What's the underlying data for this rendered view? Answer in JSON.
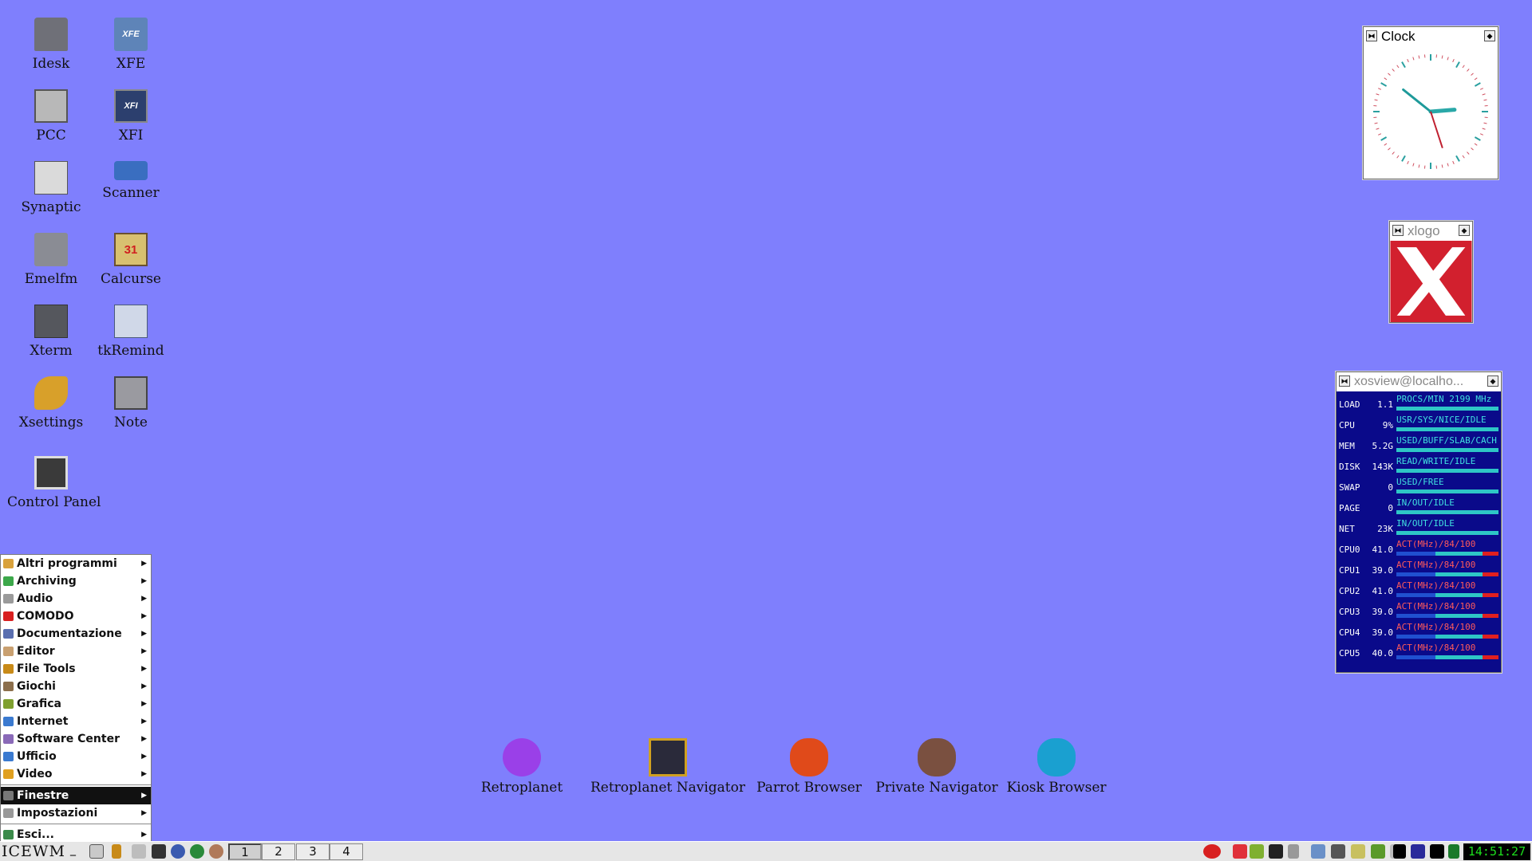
{
  "desktop_icons": [
    {
      "label": "Idesk",
      "icon": "idesk-icon"
    },
    {
      "label": "XFE",
      "icon": "xfe-icon",
      "text": "XFE"
    },
    {
      "label": "PCC",
      "icon": "pcc-icon"
    },
    {
      "label": "XFI",
      "icon": "xfi-icon",
      "text": "XFI"
    },
    {
      "label": "Synaptic",
      "icon": "synaptic-icon"
    },
    {
      "label": "Scanner",
      "icon": "scanner-icon"
    },
    {
      "label": "Emelfm",
      "icon": "emelfm-icon"
    },
    {
      "label": "Calcurse",
      "icon": "calcurse-icon",
      "text": "31"
    },
    {
      "label": "Xterm",
      "icon": "xterm-icon"
    },
    {
      "label": "tkRemind",
      "icon": "tkremind-icon"
    },
    {
      "label": "Xsettings",
      "icon": "xsettings-icon"
    },
    {
      "label": "Note",
      "icon": "note-icon"
    },
    {
      "label": "Control Panel",
      "icon": "control-panel-icon"
    }
  ],
  "bottom_icons": [
    {
      "label": "Retroplanet",
      "icon": "retroplanet-icon"
    },
    {
      "label": "Retroplanet Navigator",
      "icon": "retroplanet-navigator-icon"
    },
    {
      "label": "Parrot Browser",
      "icon": "parrot-browser-icon"
    },
    {
      "label": "Private Navigator",
      "icon": "private-navigator-icon"
    },
    {
      "label": "Kiosk Browser",
      "icon": "kiosk-browser-icon"
    }
  ],
  "start_menu": {
    "items": [
      {
        "label": "Altri programmi",
        "color": "#d9a23c"
      },
      {
        "label": "Archiving",
        "color": "#3ca84a"
      },
      {
        "label": "Audio",
        "color": "#9a9a9a"
      },
      {
        "label": "COMODO",
        "color": "#d82020"
      },
      {
        "label": "Documentazione",
        "color": "#5a6fb0"
      },
      {
        "label": "Editor",
        "color": "#c9a070"
      },
      {
        "label": "File Tools",
        "color": "#c88a18"
      },
      {
        "label": "Giochi",
        "color": "#8c6f4c"
      },
      {
        "label": "Grafica",
        "color": "#7fa030"
      },
      {
        "label": "Internet",
        "color": "#3b7ad0"
      },
      {
        "label": "Software Center",
        "color": "#8a6ab8"
      },
      {
        "label": "Ufficio",
        "color": "#3b7ad0"
      },
      {
        "label": "Video",
        "color": "#e0a020"
      }
    ],
    "selected": "Finestre",
    "settings": "Impostazioni",
    "exit": "Esci..."
  },
  "clock_window": {
    "title": "Clock",
    "time": "14:51:27",
    "hour": 14,
    "minute": 51,
    "second": 27
  },
  "xlogo_window": {
    "title": "xlogo",
    "accent": "#d2202e"
  },
  "xosview": {
    "title": "xosview@localho...",
    "rows": [
      {
        "name": "LOAD",
        "value": "1.1",
        "legend": "PROCS/MIN 2199 MHz"
      },
      {
        "name": "CPU",
        "value": "9%",
        "legend": "USR/SYS/NICE/IDLE"
      },
      {
        "name": "MEM",
        "value": "5.2G",
        "legend": "USED/BUFF/SLAB/CACH"
      },
      {
        "name": "DISK",
        "value": "143K",
        "legend": "READ/WRITE/IDLE"
      },
      {
        "name": "SWAP",
        "value": "0",
        "legend": "USED/FREE"
      },
      {
        "name": "PAGE",
        "value": "0",
        "legend": "IN/OUT/IDLE"
      },
      {
        "name": "NET",
        "value": "23K",
        "legend": "IN/OUT/IDLE"
      },
      {
        "name": "CPU0",
        "value": "41.0",
        "legend": "ACT(MHz)/84/100"
      },
      {
        "name": "CPU1",
        "value": "39.0",
        "legend": "ACT(MHz)/84/100"
      },
      {
        "name": "CPU2",
        "value": "41.0",
        "legend": "ACT(MHz)/84/100"
      },
      {
        "name": "CPU3",
        "value": "39.0",
        "legend": "ACT(MHz)/84/100"
      },
      {
        "name": "CPU4",
        "value": "39.0",
        "legend": "ACT(MHz)/84/100"
      },
      {
        "name": "CPU5",
        "value": "40.0",
        "legend": "ACT(MHz)/84/100"
      }
    ]
  },
  "taskbar": {
    "logo": "ICEWM",
    "workspaces": [
      "1",
      "2",
      "3",
      "4"
    ],
    "active_workspace": "1",
    "clock": "14:51:27",
    "colors": {
      "taskbar": "#e6e6e6",
      "desktop": "#7f7ffd",
      "clock_text": "#1de01d"
    }
  }
}
